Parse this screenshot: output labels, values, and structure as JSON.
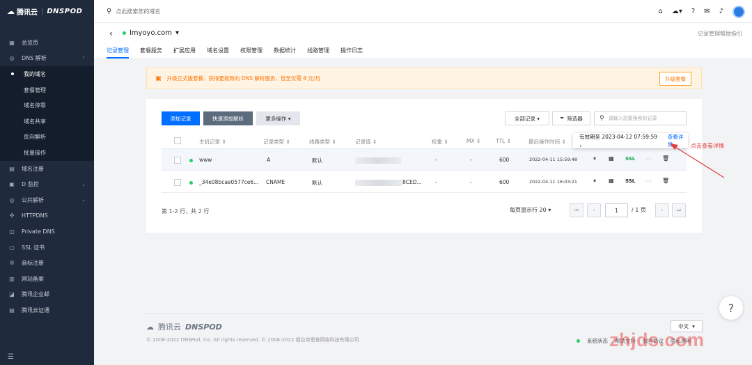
{
  "brand": {
    "left": "腾讯云",
    "right": "DNSPOD"
  },
  "sidebar": {
    "top_items": [
      {
        "icon": "▦",
        "label": "总览页"
      },
      {
        "icon": "◎",
        "label": "DNS 解析",
        "arrow": "⌃"
      }
    ],
    "sub_items": [
      {
        "label": "我的域名",
        "active": true
      },
      {
        "label": "套餐管理"
      },
      {
        "label": "域名停靠"
      },
      {
        "label": "域名共享"
      },
      {
        "label": "反向解析"
      },
      {
        "label": "批量操作"
      }
    ],
    "bottom_items": [
      {
        "icon": "▤",
        "label": "域名注册"
      },
      {
        "icon": "▣",
        "label": "D 监控",
        "arrow": "⌄"
      },
      {
        "icon": "◎",
        "label": "公共解析",
        "arrow": "⌄"
      },
      {
        "icon": "✣",
        "label": "HTTPDNS"
      },
      {
        "icon": "◫",
        "label": "Private DNS"
      },
      {
        "icon": "▢",
        "label": "SSL 证书"
      },
      {
        "icon": "®",
        "label": "商标注册"
      },
      {
        "icon": "▥",
        "label": "网站备案"
      },
      {
        "icon": "◪",
        "label": "腾讯企业邮"
      },
      {
        "icon": "▤",
        "label": "腾讯云证通"
      }
    ]
  },
  "topbar": {
    "search_placeholder": "点此搜索您的域名"
  },
  "header": {
    "domain": "lmyoyo.com",
    "help_link": "记录管理帮助指引",
    "tabs": [
      "记录管理",
      "套餐服务",
      "扩展应用",
      "域名设置",
      "权限管理",
      "数据统计",
      "线路管理",
      "操作日志"
    ]
  },
  "notice": {
    "text": "升级正式版套餐，获得更极致的 DNS 解析服务，低至仅需 8 元/月",
    "button": "升级套餐"
  },
  "toolbar": {
    "add": "添加记录",
    "quick_add": "快速添加解析",
    "more": "更多操作 ▾",
    "all_records": "全部记录 ▾",
    "filter": "筛选器",
    "search_placeholder": "请输入您要搜索的记录"
  },
  "table": {
    "headers": [
      "主机记录",
      "记录类型",
      "线路类型",
      "记录值",
      "权重",
      "MX",
      "TTL",
      "最后操作时间"
    ],
    "rows": [
      {
        "host": "www",
        "type": "A",
        "line": "默认",
        "value": "",
        "weight": "-",
        "mx": "-",
        "ttl": "600",
        "time": "2022-04-11 15:59:48",
        "ssl": "SSL"
      },
      {
        "host": "_34e08bcae0577ce6...",
        "type": "CNAME",
        "line": "默认",
        "value": "8CED...",
        "weight": "-",
        "mx": "-",
        "ttl": "600",
        "time": "2022-04-11 16:03:21",
        "ssl": "SSL"
      }
    ]
  },
  "tooltip": {
    "text": "有效期至 2023-04-12 07:59:59 ，",
    "link": "查看详情"
  },
  "annotation": "点击查看详情",
  "pagination": {
    "summary": "第 1-2 行，共 2 行",
    "page_size": "每页显示行 20 ▾",
    "current": "1",
    "total": "/ 1 页"
  },
  "footer": {
    "logo_left": "腾讯云",
    "logo_right": "DNSPOD",
    "copyright": "© 2006-2022 DNSPod, Inc. All rights reserved. © 2006-2022 烟台帝思普网络科技有限公司",
    "lang": "中文",
    "status": "系统状态",
    "help": "帮助支持",
    "terms": "服务协议",
    "privacy": "隐私声明"
  },
  "watermark": "zhjds.com"
}
